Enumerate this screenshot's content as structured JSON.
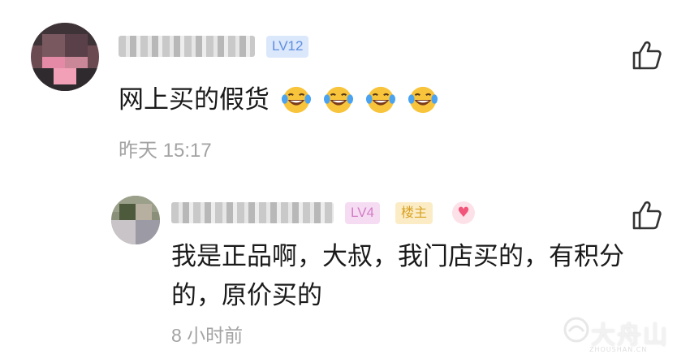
{
  "comment": {
    "level_badge": "LV12",
    "text": "网上买的假货",
    "emojis": [
      "laughing-tears-emoji",
      "laughing-tears-emoji",
      "laughing-tears-emoji",
      "laughing-tears-emoji"
    ],
    "time": "昨天 15:17",
    "like_icon": "thumbs-up-icon"
  },
  "reply": {
    "level_badge": "LV4",
    "host_badge": "楼主",
    "heart_icon": "heart-icon",
    "text": "我是正品啊，大叔，我门店买的，有积分的，原价买的",
    "time": "8 小时前",
    "like_icon": "thumbs-up-icon"
  },
  "watermark": {
    "text": "大舟山",
    "subtext": "ZHOUSHAN.CN"
  },
  "colors": {
    "lv12_bg": "#dbe7fb",
    "lv12_fg": "#5f8fe0",
    "lv4_bg": "#f6dcf2",
    "lv4_fg": "#d27cc6",
    "host_bg": "#fbecc5",
    "host_fg": "#d8a224",
    "heart": "#f2557a",
    "timestamp": "#a3a3a3"
  }
}
